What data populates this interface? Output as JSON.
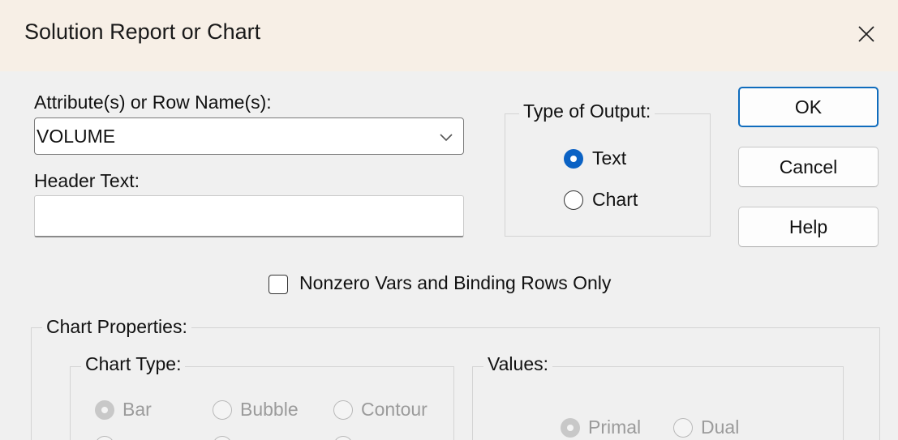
{
  "window": {
    "title": "Solution Report or Chart",
    "close_icon": "close-icon"
  },
  "attributes": {
    "label": "Attribute(s) or Row Name(s):",
    "value": "VOLUME"
  },
  "header_text": {
    "label": "Header Text:",
    "value": ""
  },
  "output_type": {
    "label": "Type of Output:",
    "options": [
      {
        "label": "Text",
        "checked": true
      },
      {
        "label": "Chart",
        "checked": false
      }
    ]
  },
  "buttons": {
    "ok": "OK",
    "cancel": "Cancel",
    "help": "Help"
  },
  "nonzero_checkbox": {
    "label": "Nonzero Vars and Binding Rows Only",
    "checked": false
  },
  "chart_properties": {
    "label": "Chart Properties:",
    "chart_type": {
      "label": "Chart Type:",
      "options": [
        {
          "label": "Bar",
          "checked": true
        },
        {
          "label": "Bubble",
          "checked": false
        },
        {
          "label": "Contour",
          "checked": false
        }
      ]
    },
    "values": {
      "label": "Values:",
      "options": [
        {
          "label": "Primal",
          "checked": true
        },
        {
          "label": "Dual",
          "checked": false
        }
      ]
    }
  },
  "colors": {
    "accent": "#0f6cbd",
    "title_bar": "#f7efe6",
    "dialog_bg": "#f0f0f0",
    "disabled_text": "#9b9b9b"
  }
}
